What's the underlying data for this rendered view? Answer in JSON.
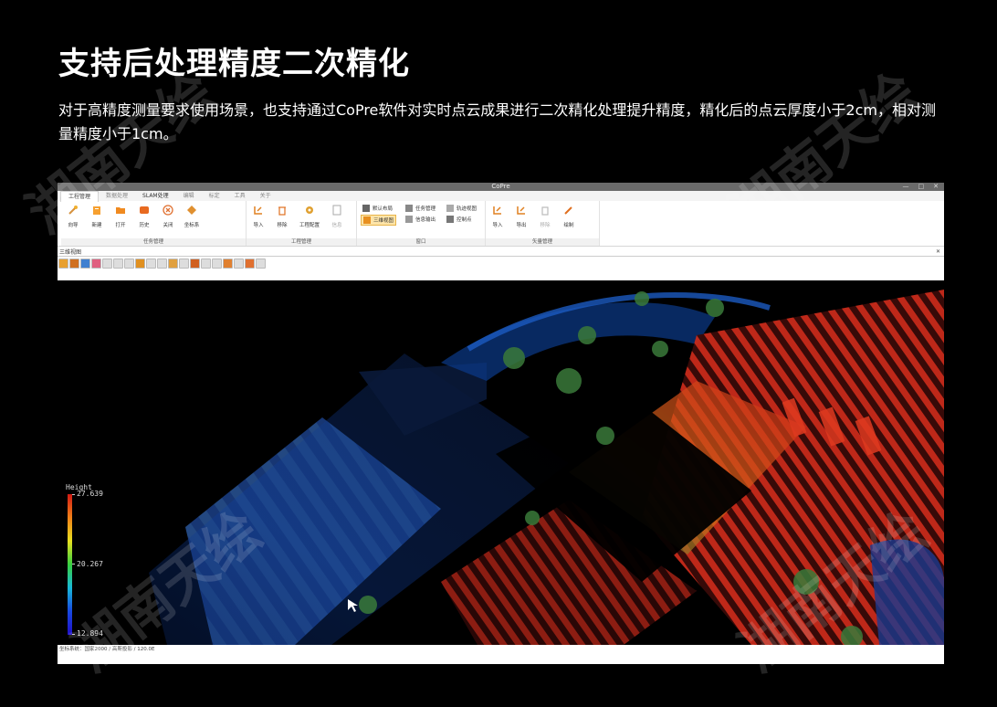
{
  "heading": "支持后处理精度二次精化",
  "description": "对于高精度测量要求使用场景，也支持通过CoPre软件对实时点云成果进行二次精化处理提升精度，精化后的点云厚度小于2cm，相对测量精度小于1cm。",
  "app": {
    "title": "CoPre",
    "window_buttons": [
      "—",
      "□",
      "✕"
    ],
    "menu_tabs": [
      "工程管理",
      "数据处理",
      "SLAM处理",
      "编辑",
      "标定",
      "工具",
      "关于"
    ],
    "ribbon_groups": [
      {
        "name": "任务管理",
        "buttons": [
          "向导",
          "新建",
          "打开",
          "历史",
          "关闭",
          "坐标系"
        ]
      },
      {
        "name": "工程管理",
        "buttons": [
          "导入",
          "移除",
          "工程配置",
          "信息"
        ]
      },
      {
        "name": "窗口",
        "small_buttons": [
          [
            "默认布局",
            "三维视图"
          ],
          [
            "任务管理",
            "信息输出"
          ],
          [
            "轨迹视图",
            "控制点"
          ]
        ]
      },
      {
        "name": "矢量管理",
        "buttons": [
          "导入",
          "导出",
          "移除",
          "绘制"
        ]
      }
    ],
    "panel_title": "三维视图",
    "legend": {
      "title": "Height",
      "max": "27.639",
      "mid": "20.267",
      "min": "12.894"
    },
    "status": "坐标系统：国家2000 / 高斯投影 / 120.0E"
  },
  "watermark_text": "湖南天绘",
  "colors": {
    "background": "#000000",
    "active_tab": "#ffffff",
    "highlight": "#fde4a8"
  }
}
